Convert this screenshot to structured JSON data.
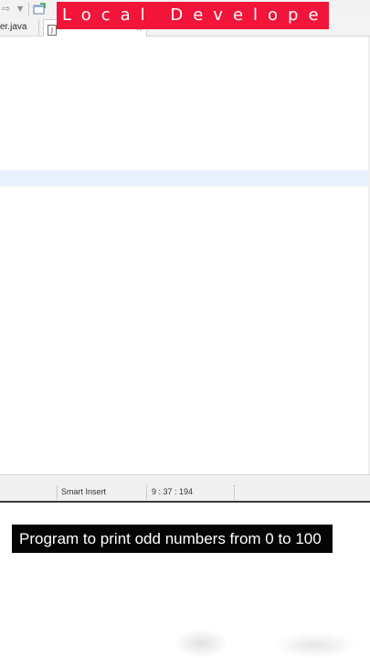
{
  "banner": {
    "text": "Local Developer",
    "color": "#f21439"
  },
  "toolbar": {
    "forward_icon": "arrow-right-icon",
    "dropdown_icon": "chevron-down-icon",
    "open_icon": "open-type-icon"
  },
  "tabs": [
    {
      "label": "er.java",
      "active": false
    },
    {
      "label": "",
      "active": true,
      "icon": "java-file-icon"
    }
  ],
  "status_bar": {
    "insert_mode": "Smart Insert",
    "position": "9 : 37 : 194"
  },
  "caption": "Program to print odd numbers from 0 to 100",
  "colors": {
    "current_line": "#e8f2fe",
    "caption_bg": "#050505"
  }
}
